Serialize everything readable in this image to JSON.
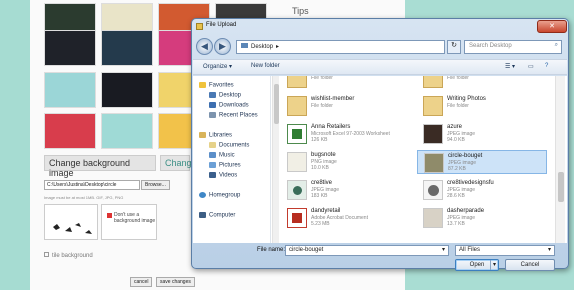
{
  "background": {
    "tips_label": "Tips",
    "change_bg_button": "Change background image",
    "change_bg_button2": "Chang",
    "path_value": "C:\\Users\\Justina\\Desktop\\circle",
    "browse_button": "Browse...",
    "hint_text": "Image must be at most 1MB. GIF, JPG, PNG",
    "dont_use_label": "Don't use a background image",
    "tile_label": "tile background",
    "cancel_button": "cancel",
    "save_button": "save changes"
  },
  "dialog": {
    "title": "File Upload",
    "address": "Desktop",
    "search_placeholder": "Search Desktop",
    "toolbar": {
      "organize": "Organize ▾",
      "new_folder": "New folder"
    },
    "nav": [
      {
        "label": "Favorites",
        "icon": "star-icon"
      },
      {
        "label": "Desktop",
        "icon": "desktop-icon"
      },
      {
        "label": "Downloads",
        "icon": "downloads-icon"
      },
      {
        "label": "Recent Places",
        "icon": "recent-icon"
      },
      {
        "label": "Libraries",
        "icon": "library-icon"
      },
      {
        "label": "Documents",
        "icon": "document-icon"
      },
      {
        "label": "Music",
        "icon": "music-icon"
      },
      {
        "label": "Pictures",
        "icon": "pictures-icon"
      },
      {
        "label": "Videos",
        "icon": "videos-icon"
      },
      {
        "label": "Homegroup",
        "icon": "homegroup-icon"
      },
      {
        "label": "Computer",
        "icon": "computer-icon"
      }
    ],
    "files_left": [
      {
        "name": "",
        "type": "File folder",
        "size": ""
      },
      {
        "name": "wishlist-member",
        "type": "File folder",
        "size": ""
      },
      {
        "name": "Anna Retailers",
        "type": "Microsoft Excel 97-2003 Worksheet",
        "size": "126 KB"
      },
      {
        "name": "bugsnote",
        "type": "PNG image",
        "size": "10.0 KB"
      },
      {
        "name": "cre8tive",
        "type": "JPEG image",
        "size": "183 KB"
      },
      {
        "name": "dandyretail",
        "type": "Adobe Acrobat Document",
        "size": "5.23 MB"
      }
    ],
    "files_right": [
      {
        "name": "",
        "type": "File folder",
        "size": ""
      },
      {
        "name": "Writing Photos",
        "type": "File folder",
        "size": ""
      },
      {
        "name": "azure",
        "type": "JPEG image",
        "size": "94.0 KB"
      },
      {
        "name": "circle-bouget",
        "type": "JPEG image",
        "size": "87.2 KB"
      },
      {
        "name": "cre8tivedesignsfu",
        "type": "JPEG image",
        "size": "28.6 KB"
      },
      {
        "name": "dasherparade",
        "type": "JPEG image",
        "size": "13.7 KB"
      }
    ],
    "filename_label": "File name:",
    "filename_value": "circle-bouget",
    "filter_value": "All Files",
    "open_button": "Open",
    "cancel_button": "Cancel"
  }
}
